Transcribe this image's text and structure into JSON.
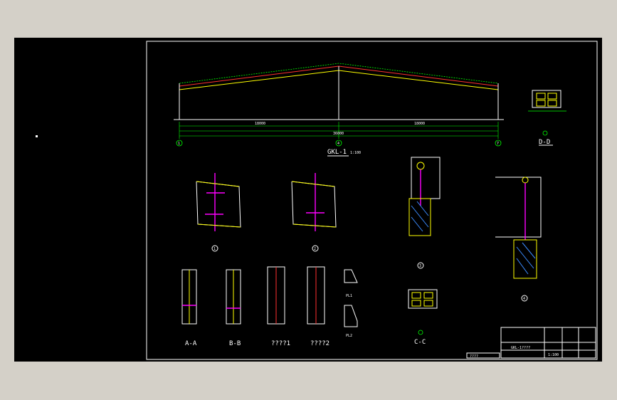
{
  "drawing": {
    "main_title": "GKL-1",
    "main_scale": "1:100",
    "section_dd": "D-D",
    "section_cc": "C-C",
    "section_aa": "A-A",
    "section_bb": "B-B",
    "section_q1": "????1",
    "section_q2": "????2",
    "detail_1": "1",
    "detail_2": "2",
    "detail_3": "3",
    "detail_4": "4",
    "grid_axes": [
      "1",
      "4",
      "7"
    ],
    "dim_total": "36000",
    "dim_left": "18000",
    "dim_right": "18000",
    "plate_1": "PL1",
    "plate_2": "PL2"
  },
  "title_block": {
    "drawing_name": "GKL-1????",
    "left_label": "????",
    "scale_cell": "1:100"
  },
  "colors": {
    "model_bg": "#000000",
    "frame": "#ffffff",
    "dimension": "#00ff00",
    "member": "#ff00ff",
    "concrete": "#ffff00",
    "hatch": "#3c8cff"
  }
}
